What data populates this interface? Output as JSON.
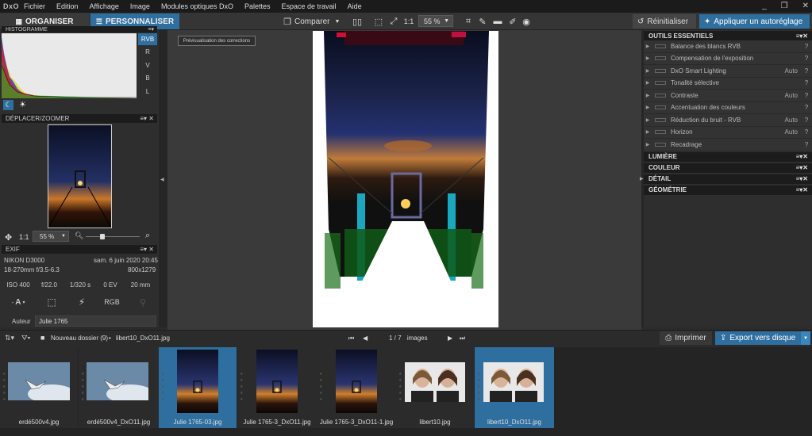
{
  "app": {
    "logo": "DxO"
  },
  "menu": [
    "Fichier",
    "Edition",
    "Affichage",
    "Image",
    "Modules optiques DxO",
    "Palettes",
    "Espace de travail",
    "Aide"
  ],
  "window_controls": [
    "_",
    "❐",
    "✕"
  ],
  "tabs": {
    "organiser": "ORGANISER",
    "personnaliser": "PERSONNALISER"
  },
  "toolbar": {
    "compare": "Comparer",
    "ratio": "1:1",
    "zoom": "55 %",
    "reset": "Réinitialiser",
    "auto": "Appliquer un autoréglage"
  },
  "histogram": {
    "title": "HISTOGRAMME",
    "channels": [
      "RVB",
      "R",
      "V",
      "B",
      "L"
    ],
    "selected": "RVB"
  },
  "navigator": {
    "title": "DÉPLACER/ZOOMER",
    "ratio": "1:1",
    "zoom": "55 %"
  },
  "exif": {
    "title": "EXIF",
    "camera": "NIKON D3000",
    "date": "sam. 6 juin 2020 20:45",
    "lens": "18-270mm f/3.5-6.3",
    "dims": "800x1279",
    "iso": "ISO 400",
    "aperture": "f/22.0",
    "shutter": "1/320 s",
    "ev": "0 EV",
    "focal": "20 mm",
    "mode_a": "A",
    "color": "RGB",
    "author_label": "Auteur",
    "author": "Julie 1765"
  },
  "preview_tooltip": "Prévisualisation des corrections",
  "right_panel": {
    "title": "OUTILS ESSENTIELS",
    "tools": [
      {
        "name": "Balance des blancs RVB",
        "val": ""
      },
      {
        "name": "Compensation de l'exposition",
        "val": ""
      },
      {
        "name": "DxO Smart Lighting",
        "val": "Auto"
      },
      {
        "name": "Tonalité sélective",
        "val": ""
      },
      {
        "name": "Contraste",
        "val": "Auto"
      },
      {
        "name": "Accentuation des couleurs",
        "val": ""
      },
      {
        "name": "Réduction du bruit - RVB",
        "val": "Auto"
      },
      {
        "name": "Horizon",
        "val": "Auto"
      },
      {
        "name": "Recadrage",
        "val": ""
      }
    ],
    "sections": [
      "LUMIÈRE",
      "COULEUR",
      "DÉTAIL",
      "GÉOMÉTRIE"
    ]
  },
  "filmstrip": {
    "folder": "Nouveau dossier (9)",
    "file": "libert10_DxO11.jpg",
    "counter": "1 / 7",
    "counter_label": "images",
    "print": "Imprimer",
    "export": "Export vers disque",
    "thumbs": [
      {
        "name": "erdé500v4.jpg",
        "kind": "bird",
        "selected": false
      },
      {
        "name": "erdé500v4_DxO11.jpg",
        "kind": "bird",
        "selected": false
      },
      {
        "name": "Julie 1765-03.jpg",
        "kind": "sunset",
        "selected": true
      },
      {
        "name": "Julie 1765-3_DxO11.jpg",
        "kind": "sunset",
        "selected": false
      },
      {
        "name": "Julie 1765-3_DxO11-1.jpg",
        "kind": "sunset",
        "selected": false
      },
      {
        "name": "libert10.jpg",
        "kind": "people",
        "selected": false
      },
      {
        "name": "libert10_DxO11.jpg",
        "kind": "people",
        "selected": true
      }
    ]
  },
  "colors": {
    "accent": "#2f6f9f",
    "panel": "#2e2e2e",
    "header": "#1c1c1c"
  }
}
